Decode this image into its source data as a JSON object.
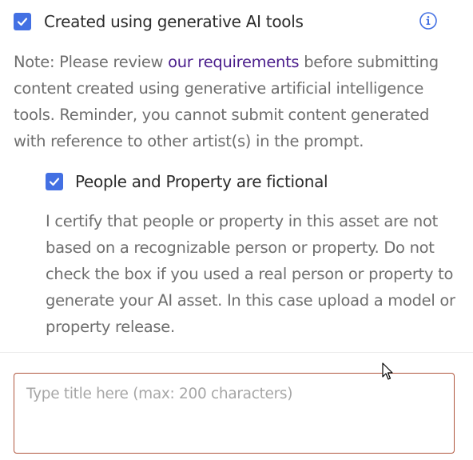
{
  "gen_ai": {
    "checkbox_checked": true,
    "label": "Created using generative AI tools",
    "info_icon": "info-icon",
    "note_prefix": "Note: Please review ",
    "note_link": "our requirements",
    "note_suffix": " before submitting content created using generative artificial intelligence tools. Reminder, you cannot submit content generated with reference to other artist(s) in the prompt."
  },
  "fictional": {
    "checkbox_checked": true,
    "label": "People and Property are fictional",
    "description": "I certify that people or property in this asset are not based on a recognizable person or property. Do not check the box if you used a real person or property to generate your AI asset. In this case upload a model or property release."
  },
  "title_field": {
    "value": "",
    "placeholder": "Type title here (max: 200 characters)"
  },
  "colors": {
    "checkbox": "#4370e3",
    "link": "#4b1e8c",
    "info_icon": "#4370e3",
    "input_border": "#b0573f",
    "note_text": "#6e6e6e"
  }
}
